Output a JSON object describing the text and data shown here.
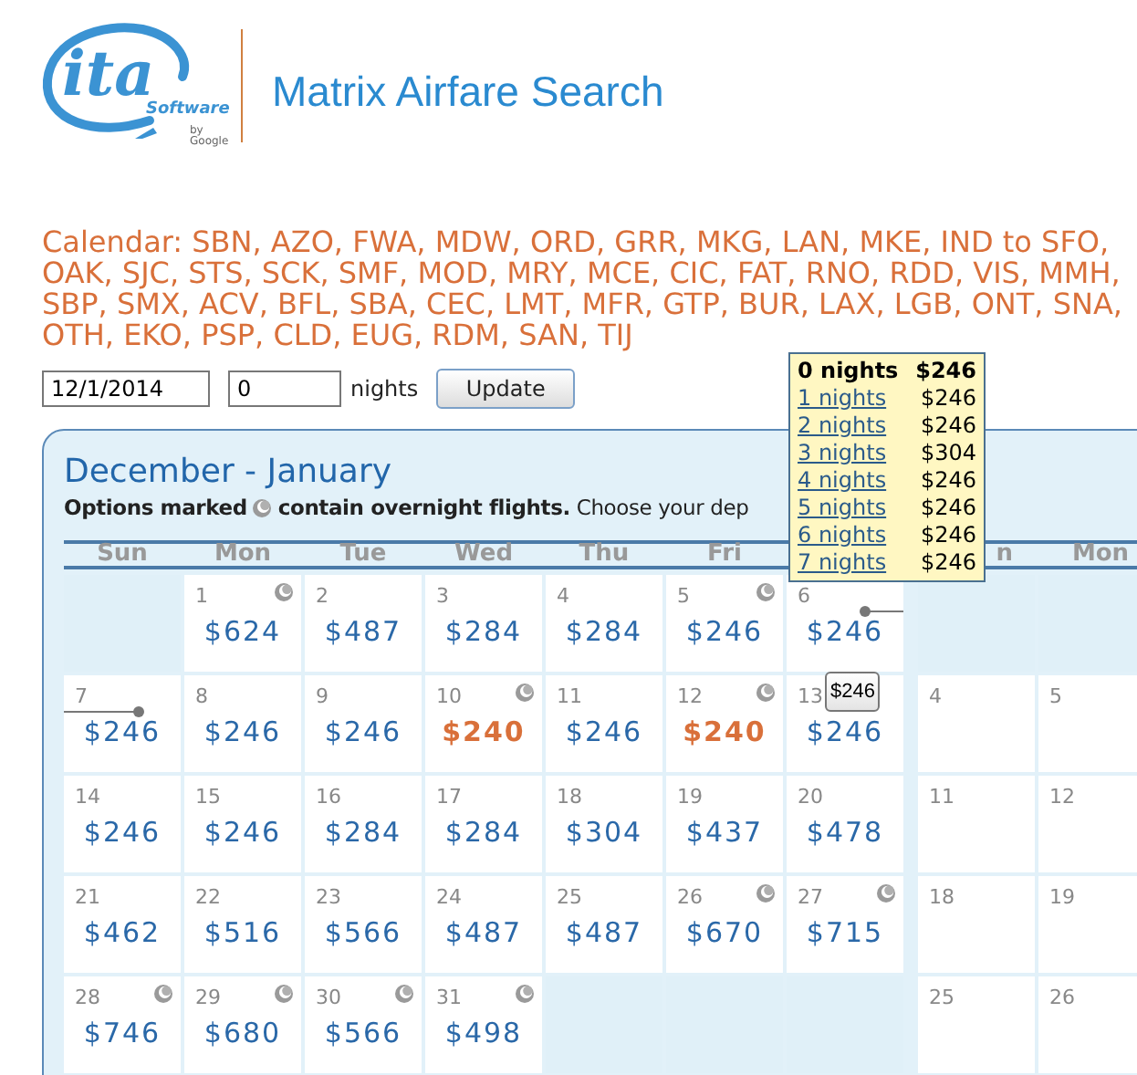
{
  "header": {
    "logo": {
      "mark": "ita",
      "product": "Software",
      "byline": "by Google"
    },
    "title": "Matrix Airfare Search"
  },
  "route": "Calendar: SBN, AZO, FWA, MDW, ORD, GRR, MKG, LAN, MKE, IND to SFO, OAK, SJC, STS, SCK, SMF, MOD, MRY, MCE, CIC, FAT, RNO, RDD, VIS, MMH, SBP, SMX, ACV, BFL, SBA, CEC, LMT, MFR, GTP, BUR, LAX, LGB, ONT, SNA, OTH, EKO, PSP, CLD, EUG, RDM, SAN, TIJ",
  "form": {
    "date": "12/1/2014",
    "nights": "0",
    "nights_label": "nights",
    "button": "Update"
  },
  "calendar": {
    "title": "December - January",
    "note_start": "Options marked",
    "note_end": "**contain overnight flights.** Choose your dep",
    "month_1_days": [
      "Sun",
      "Mon",
      "Tue",
      "Wed",
      "Thu",
      "Fri"
    ],
    "month_2_days": [
      "n",
      "Mon"
    ],
    "weeks": [
      {
        "month_1": [
          {
            "kind": "blank"
          },
          {
            "kind": "day",
            "day": "1",
            "price": "$624",
            "overnight": true,
            "lowest": false
          },
          {
            "kind": "day",
            "day": "2",
            "price": "$487",
            "overnight": false,
            "lowest": false
          },
          {
            "kind": "day",
            "day": "3",
            "price": "$284",
            "overnight": false,
            "lowest": false
          },
          {
            "kind": "day",
            "day": "4",
            "price": "$284",
            "overnight": false,
            "lowest": false
          },
          {
            "kind": "day",
            "day": "5",
            "price": "$246",
            "overnight": true,
            "lowest": false
          },
          {
            "kind": "day",
            "day": "6",
            "price": "$246",
            "overnight": false,
            "lowest": false,
            "range_start": true
          }
        ],
        "month_2": [
          {
            "kind": "blank"
          },
          {
            "kind": "blank"
          }
        ]
      },
      {
        "month_1": [
          {
            "kind": "day",
            "day": "7",
            "price": "$246",
            "overnight": false,
            "lowest": false,
            "range_end": true
          },
          {
            "kind": "day",
            "day": "8",
            "price": "$246",
            "overnight": false,
            "lowest": false
          },
          {
            "kind": "day",
            "day": "9",
            "price": "$246",
            "overnight": false,
            "lowest": false
          },
          {
            "kind": "day",
            "day": "10",
            "price": "$240",
            "overnight": true,
            "lowest": true
          },
          {
            "kind": "day",
            "day": "11",
            "price": "$246",
            "overnight": false,
            "lowest": false
          },
          {
            "kind": "day",
            "day": "12",
            "price": "$240",
            "overnight": true,
            "lowest": true
          },
          {
            "kind": "day",
            "day": "13",
            "price": "$246",
            "overnight": false,
            "lowest": false,
            "hover_price": "$246"
          }
        ],
        "month_2": [
          {
            "kind": "day",
            "day": "4"
          },
          {
            "kind": "day",
            "day": "5"
          }
        ]
      },
      {
        "month_1": [
          {
            "kind": "day",
            "day": "14",
            "price": "$246",
            "overnight": false,
            "lowest": false
          },
          {
            "kind": "day",
            "day": "15",
            "price": "$246",
            "overnight": false,
            "lowest": false
          },
          {
            "kind": "day",
            "day": "16",
            "price": "$284",
            "overnight": false,
            "lowest": false
          },
          {
            "kind": "day",
            "day": "17",
            "price": "$284",
            "overnight": false,
            "lowest": false
          },
          {
            "kind": "day",
            "day": "18",
            "price": "$304",
            "overnight": false,
            "lowest": false
          },
          {
            "kind": "day",
            "day": "19",
            "price": "$437",
            "overnight": false,
            "lowest": false
          },
          {
            "kind": "day",
            "day": "20",
            "price": "$478",
            "overnight": false,
            "lowest": false
          }
        ],
        "month_2": [
          {
            "kind": "day",
            "day": "11"
          },
          {
            "kind": "day",
            "day": "12"
          }
        ]
      },
      {
        "month_1": [
          {
            "kind": "day",
            "day": "21",
            "price": "$462",
            "overnight": false,
            "lowest": false
          },
          {
            "kind": "day",
            "day": "22",
            "price": "$516",
            "overnight": false,
            "lowest": false
          },
          {
            "kind": "day",
            "day": "23",
            "price": "$566",
            "overnight": false,
            "lowest": false
          },
          {
            "kind": "day",
            "day": "24",
            "price": "$487",
            "overnight": false,
            "lowest": false
          },
          {
            "kind": "day",
            "day": "25",
            "price": "$487",
            "overnight": false,
            "lowest": false
          },
          {
            "kind": "day",
            "day": "26",
            "price": "$670",
            "overnight": true,
            "lowest": false
          },
          {
            "kind": "day",
            "day": "27",
            "price": "$715",
            "overnight": true,
            "lowest": false
          }
        ],
        "month_2": [
          {
            "kind": "day",
            "day": "18"
          },
          {
            "kind": "day",
            "day": "19"
          }
        ]
      },
      {
        "month_1": [
          {
            "kind": "day",
            "day": "28",
            "price": "$746",
            "overnight": true,
            "lowest": false
          },
          {
            "kind": "day",
            "day": "29",
            "price": "$680",
            "overnight": true,
            "lowest": false
          },
          {
            "kind": "day",
            "day": "30",
            "price": "$566",
            "overnight": true,
            "lowest": false
          },
          {
            "kind": "day",
            "day": "31",
            "price": "$498",
            "overnight": true,
            "lowest": false
          },
          {
            "kind": "blank"
          },
          {
            "kind": "blank"
          },
          {
            "kind": "blank"
          }
        ],
        "month_2": [
          {
            "kind": "day",
            "day": "25"
          },
          {
            "kind": "day",
            "day": "26"
          }
        ]
      }
    ]
  },
  "nights_popup": [
    {
      "label": "0 nights",
      "price": "$246",
      "selected": true
    },
    {
      "label": "1 nights",
      "price": "$246",
      "selected": false
    },
    {
      "label": "2 nights",
      "price": "$246",
      "selected": false
    },
    {
      "label": "3 nights",
      "price": "$304",
      "selected": false
    },
    {
      "label": "4 nights",
      "price": "$246",
      "selected": false
    },
    {
      "label": "5 nights",
      "price": "$246",
      "selected": false
    },
    {
      "label": "6 nights",
      "price": "$246",
      "selected": false
    },
    {
      "label": "7 nights",
      "price": "$246",
      "selected": false
    }
  ]
}
